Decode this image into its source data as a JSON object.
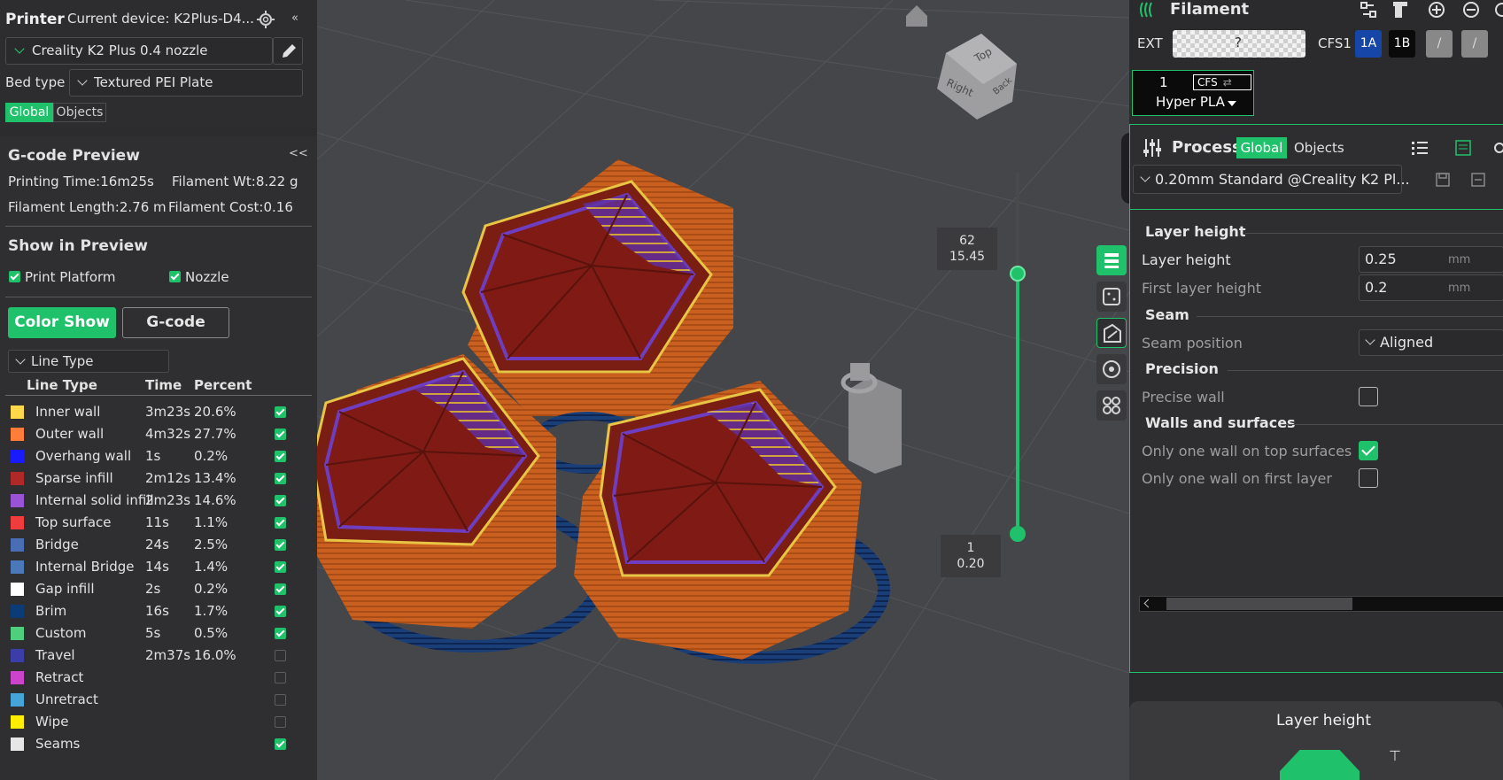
{
  "printer": {
    "title": "Printer",
    "current_device": "Current device: K2Plus-D4...",
    "preset": "Creality K2 Plus 0.4 nozzle",
    "bed_type_label": "Bed type",
    "bed_type_value": "Textured PEI Plate",
    "tab_global": "Global",
    "tab_objects": "Objects"
  },
  "gcode_preview": {
    "title": "G-code Preview",
    "collapse": "<<",
    "printing_time": "Printing Time:16m25s",
    "filament_wt": "Filament Wt:8.22 g",
    "filament_length": "Filament Length:2.76 m",
    "filament_cost": "Filament Cost:0.16"
  },
  "show_preview": {
    "title": "Show in Preview",
    "print_platform": "Print Platform",
    "nozzle": "Nozzle",
    "btn_color_show": "Color Show",
    "btn_gcode": "G-code",
    "dropdown": "Line Type"
  },
  "line_table": {
    "headers": [
      "Line Type",
      "Time",
      "Percent"
    ],
    "rows": [
      {
        "name": "Inner wall",
        "time": "3m23s",
        "percent": "20.6%",
        "color": "#ffd94a",
        "checked": true
      },
      {
        "name": "Outer wall",
        "time": "4m32s",
        "percent": "27.7%",
        "color": "#ff7d38",
        "checked": true
      },
      {
        "name": "Overhang wall",
        "time": "1s",
        "percent": "0.2%",
        "color": "#1a1aff",
        "checked": true
      },
      {
        "name": "Sparse infill",
        "time": "2m12s",
        "percent": "13.4%",
        "color": "#b02828",
        "checked": true
      },
      {
        "name": "Internal solid infill",
        "time": "2m23s",
        "percent": "14.6%",
        "color": "#9a53d6",
        "checked": true
      },
      {
        "name": "Top surface",
        "time": "11s",
        "percent": "1.1%",
        "color": "#f03c3c",
        "checked": true
      },
      {
        "name": "Bridge",
        "time": "24s",
        "percent": "2.5%",
        "color": "#4a6eb5",
        "checked": true
      },
      {
        "name": "Internal Bridge",
        "time": "14s",
        "percent": "1.4%",
        "color": "#4a78b8",
        "checked": true
      },
      {
        "name": "Gap infill",
        "time": "2s",
        "percent": "0.2%",
        "color": "#ffffff",
        "checked": true
      },
      {
        "name": "Brim",
        "time": "16s",
        "percent": "1.7%",
        "color": "#0b3c78",
        "checked": true
      },
      {
        "name": "Custom",
        "time": "5s",
        "percent": "0.5%",
        "color": "#4fcf7e",
        "checked": true
      },
      {
        "name": "Travel",
        "time": "2m37s",
        "percent": "16.0%",
        "color": "#3b3ea8",
        "checked": false
      },
      {
        "name": "Retract",
        "time": "",
        "percent": "",
        "color": "#cc44cc",
        "checked": false
      },
      {
        "name": "Unretract",
        "time": "",
        "percent": "",
        "color": "#45a5d8",
        "checked": false
      },
      {
        "name": "Wipe",
        "time": "",
        "percent": "",
        "color": "#ffee00",
        "checked": false
      },
      {
        "name": "Seams",
        "time": "",
        "percent": "",
        "color": "#e6e6e6",
        "checked": true
      }
    ]
  },
  "viewport": {
    "layer_top_index": "62",
    "layer_top_height": "15.45",
    "layer_bottom_index": "1",
    "layer_bottom_height": "0.20",
    "cube_top": "Top",
    "cube_right": "Right",
    "cube_back": "Back"
  },
  "filament": {
    "title": "Filament",
    "ext_label": "EXT",
    "ext_value": "?",
    "cfs_label": "CFS1",
    "slot_1a": "1A",
    "slot_1b": "1B",
    "slot_empty_1": "/",
    "slot_empty_2": "/",
    "card_index": "1",
    "card_cfs": "CFS",
    "card_material": "Hyper PLA"
  },
  "process": {
    "title": "Process",
    "tab_global": "Global",
    "tab_objects": "Objects",
    "preset": "0.20mm Standard @Creality K2 Pl...",
    "section_layer_height": "Layer height",
    "layer_height_label": "Layer height",
    "layer_height_value": "0.25",
    "layer_height_unit": "mm",
    "first_layer_height_label": "First layer height",
    "first_layer_height_value": "0.2",
    "first_layer_height_unit": "mm",
    "section_seam": "Seam",
    "seam_position_label": "Seam position",
    "seam_position_value": "Aligned",
    "section_precision": "Precision",
    "precise_wall_label": "Precise wall",
    "section_walls": "Walls and surfaces",
    "one_wall_top_label": "Only one wall on top surfaces",
    "one_wall_first_label": "Only one wall on first layer",
    "bottom_title": "Layer height"
  },
  "colors": {
    "accent": "#1fc26a",
    "panel": "#2c2c2e",
    "viewport": "#45464a"
  }
}
